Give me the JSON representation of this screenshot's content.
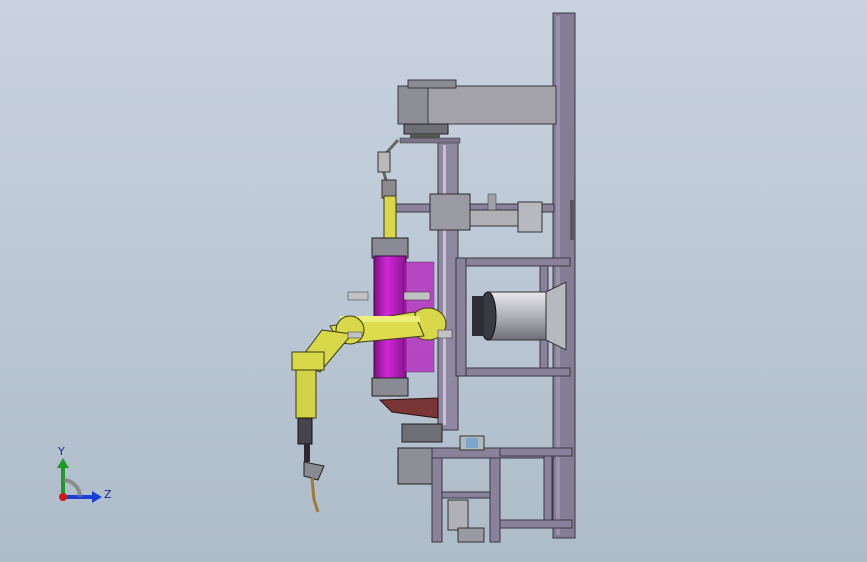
{
  "triad": {
    "y_label": "Y",
    "z_label": "Z",
    "colors": {
      "y": "#1f9a2a",
      "z": "#1a3fd6",
      "origin": "#d01818"
    }
  },
  "palette": {
    "frame": "#7f7890",
    "frame_edge": "#3a3644",
    "housing": "#9a9aa0",
    "robot": "#d8d84a",
    "robot_edge": "#3a3a10",
    "cylinder": "#c018c8",
    "positioner": "#a6a6b0"
  }
}
